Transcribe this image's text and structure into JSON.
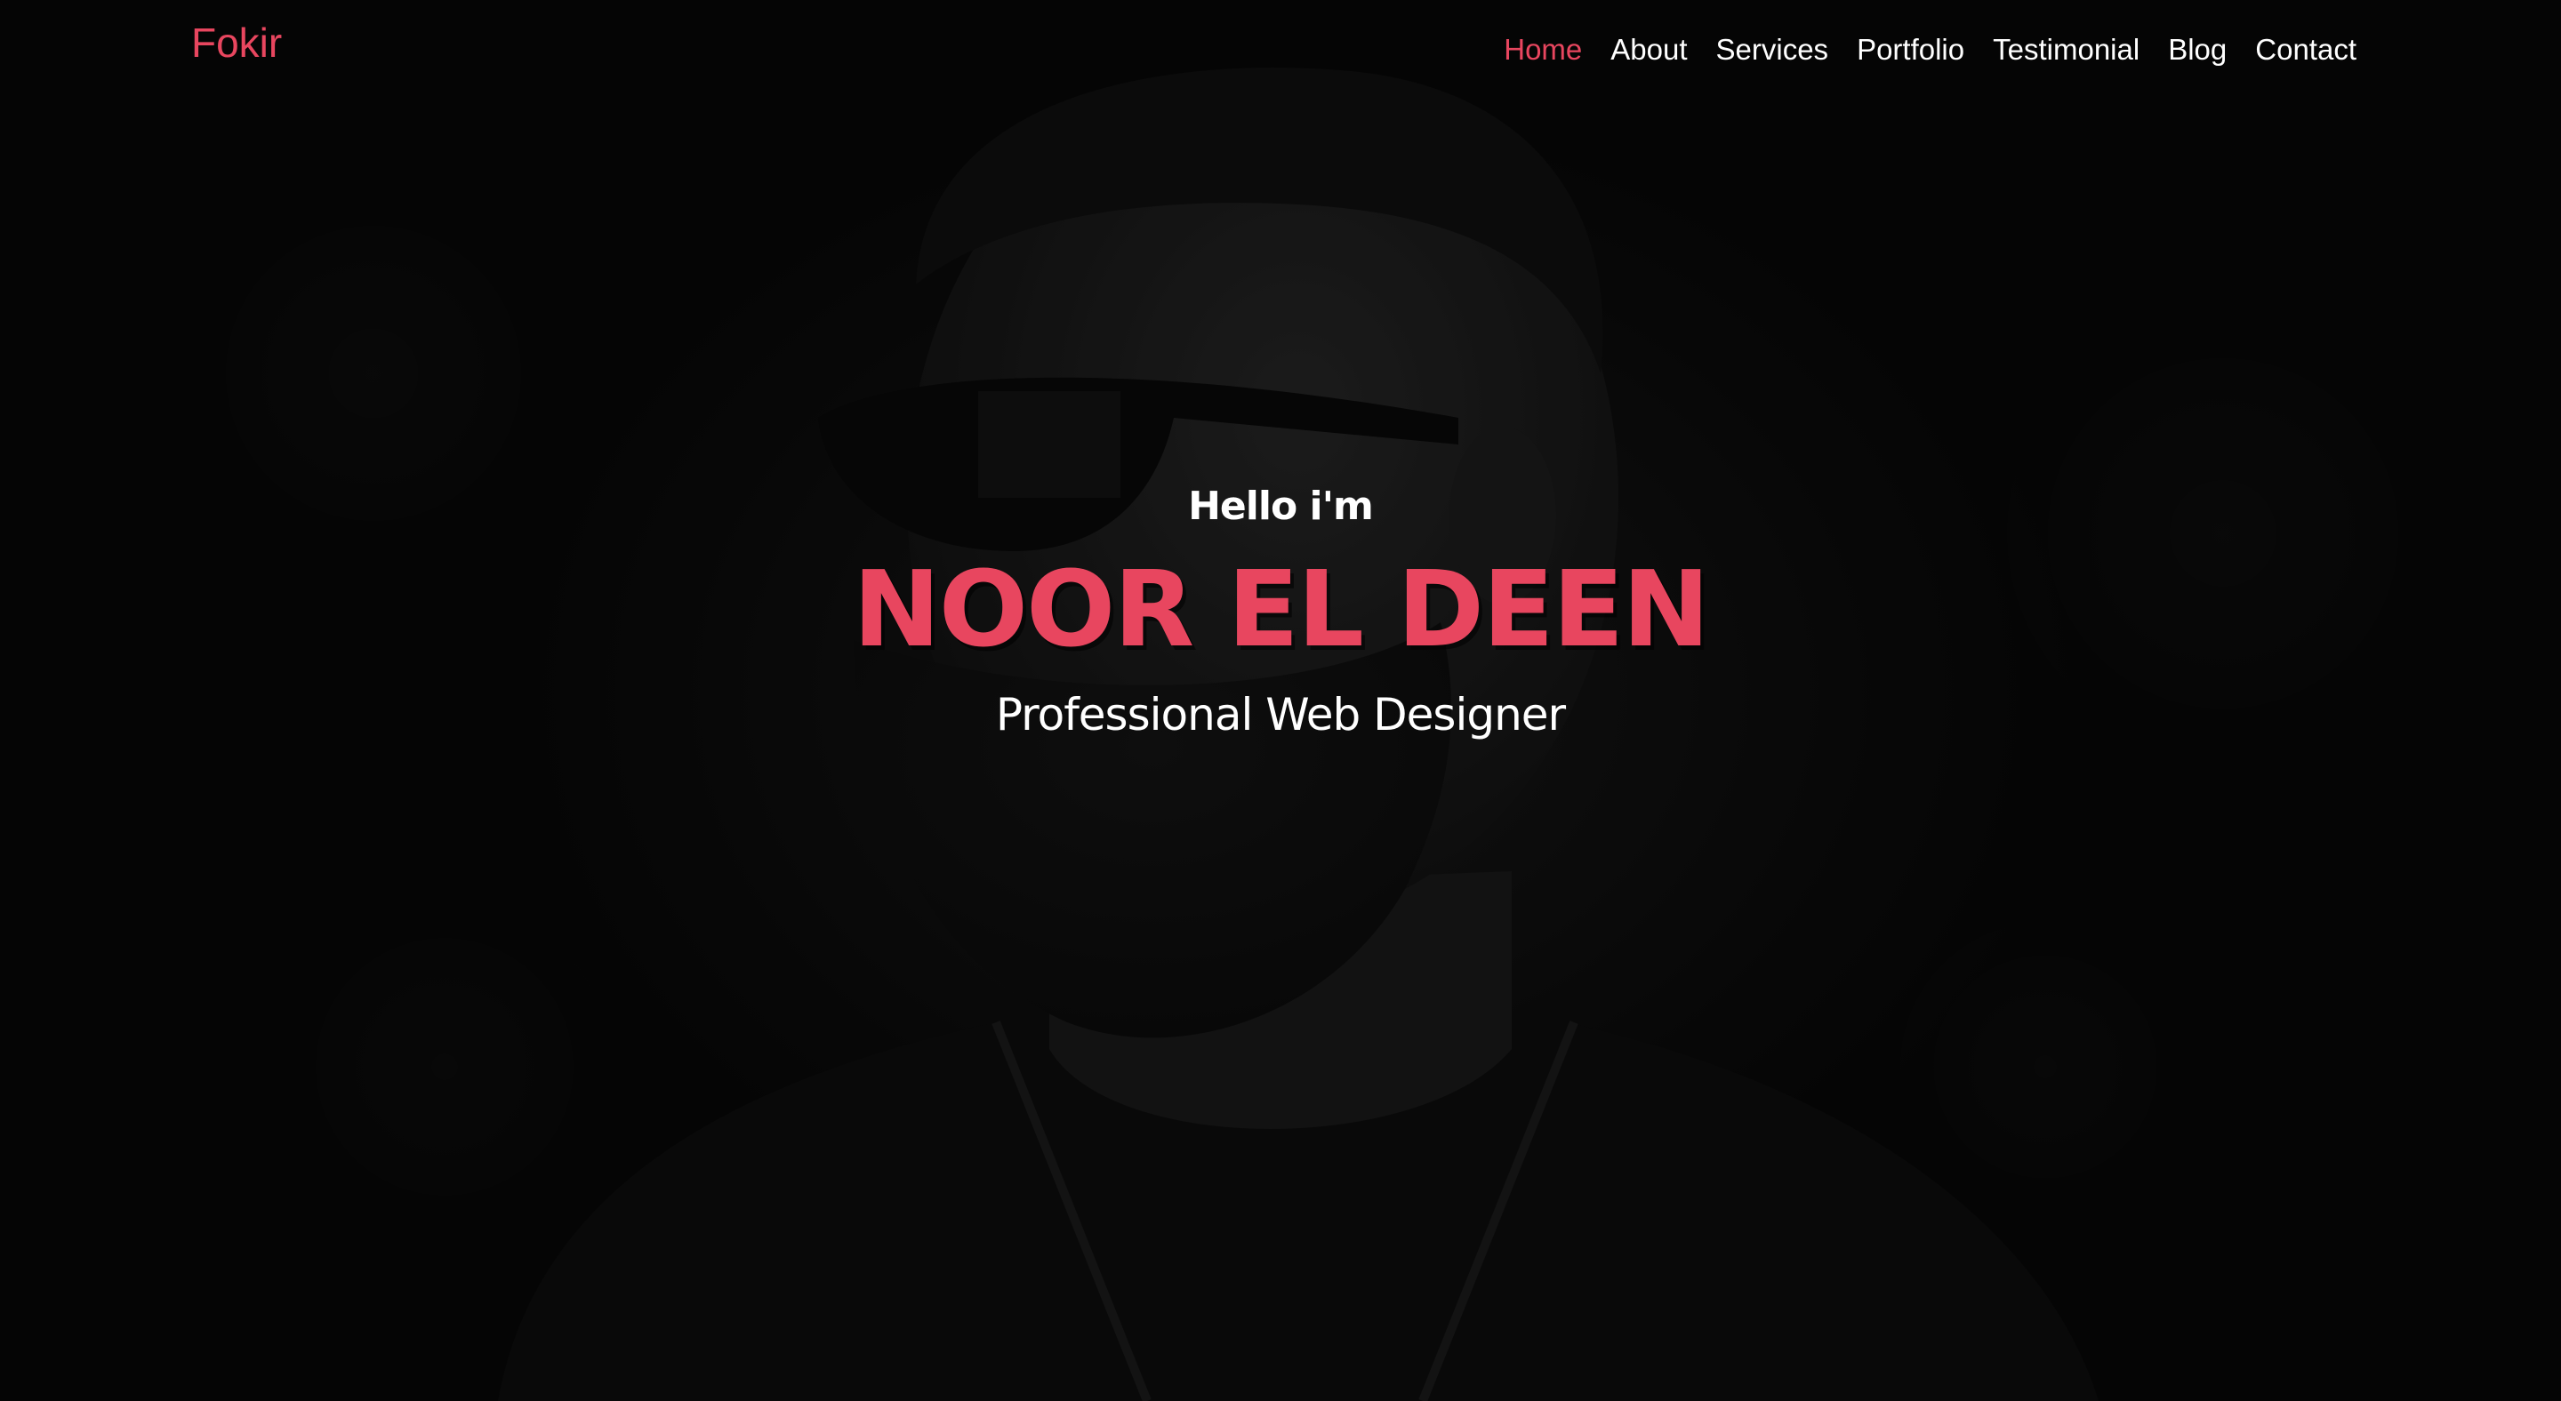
{
  "brand": {
    "logo_text": "Fokir",
    "accent_color": "#e8465f"
  },
  "nav": {
    "items": [
      {
        "label": "Home",
        "active": true
      },
      {
        "label": "About",
        "active": false
      },
      {
        "label": "Services",
        "active": false
      },
      {
        "label": "Portfolio",
        "active": false
      },
      {
        "label": "Testimonial",
        "active": false
      },
      {
        "label": "Blog",
        "active": false
      },
      {
        "label": "Contact",
        "active": false
      }
    ]
  },
  "hero": {
    "greeting": "Hello i'm",
    "name": "NOOR EL DEEN",
    "title": "Professional Web Designer",
    "background": "dark portrait photo"
  }
}
